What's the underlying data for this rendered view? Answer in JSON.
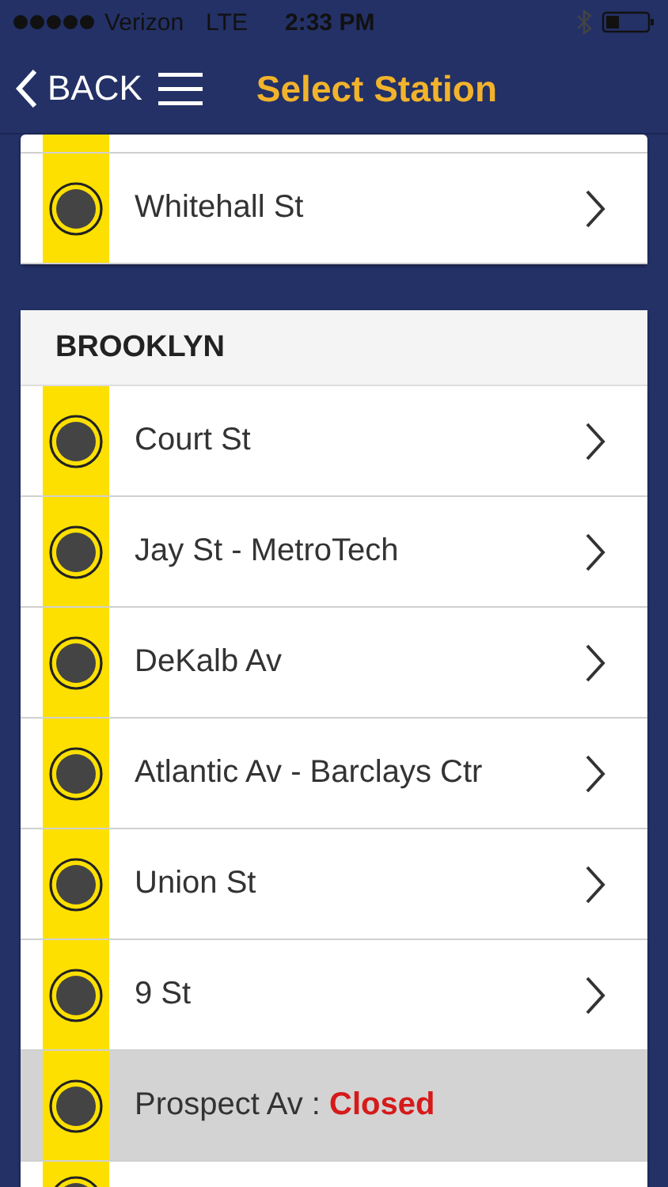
{
  "status_bar": {
    "carrier": "Verizon",
    "network": "LTE",
    "time": "2:33 PM"
  },
  "nav": {
    "back": "BACK",
    "title": "Select Station"
  },
  "sections": [
    {
      "rows": [
        {
          "name": "Whitehall St",
          "closed": false
        }
      ]
    },
    {
      "title": "BROOKLYN",
      "rows": [
        {
          "name": "Court St",
          "closed": false
        },
        {
          "name": "Jay St - MetroTech",
          "closed": false
        },
        {
          "name": "DeKalb Av",
          "closed": false
        },
        {
          "name": "Atlantic Av - Barclays Ctr",
          "closed": false
        },
        {
          "name": "Union St",
          "closed": false
        },
        {
          "name": "9 St",
          "closed": false
        },
        {
          "name": "Prospect Av :",
          "closed": true,
          "status": "Closed"
        }
      ]
    }
  ]
}
